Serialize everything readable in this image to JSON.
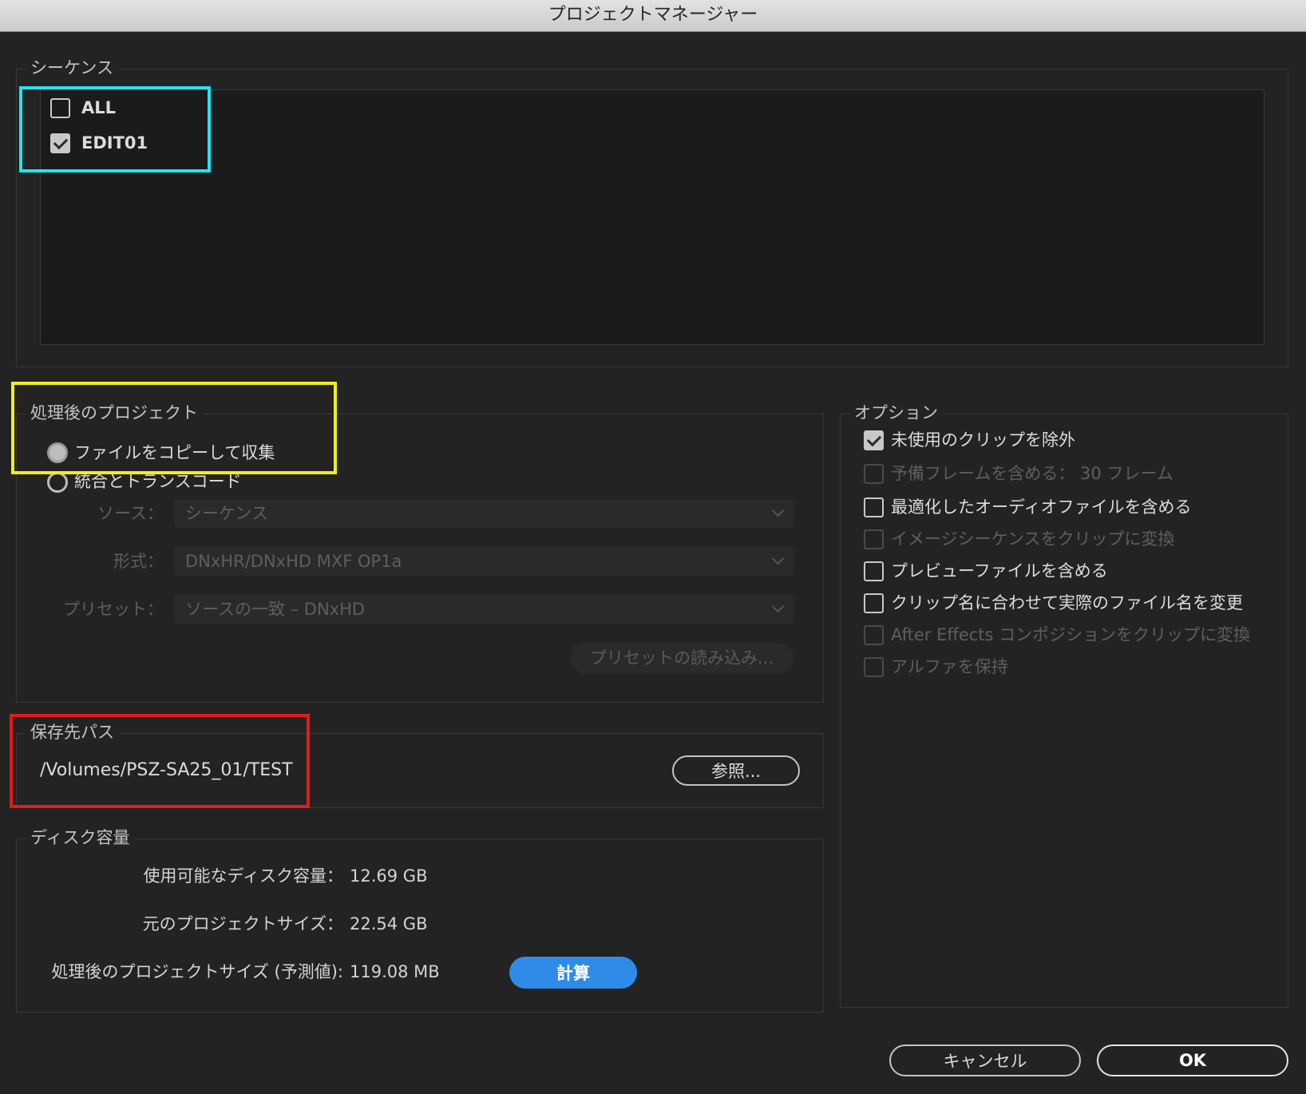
{
  "window": {
    "title": "プロジェクトマネージャー"
  },
  "sequences": {
    "title": "シーケンス",
    "items": [
      {
        "label": "ALL",
        "checked": false
      },
      {
        "label": "EDIT01",
        "checked": true
      }
    ]
  },
  "resulting_project": {
    "title": "処理後のプロジェクト",
    "options": [
      {
        "label": "ファイルをコピーして収集",
        "selected": true
      },
      {
        "label": "統合とトランスコード",
        "selected": false
      }
    ],
    "source_label": "ソース：",
    "source_value": "シーケンス",
    "format_label": "形式：",
    "format_value": "DNxHR/DNxHD MXF OP1a",
    "preset_label": "プリセット：",
    "preset_value": "ソースの一致 – DNxHD",
    "import_preset_button": "プリセットの読み込み..."
  },
  "destination": {
    "title": "保存先パス",
    "path": "/Volumes/PSZ-SA25_01/TEST",
    "browse_button": "参照..."
  },
  "disk_space": {
    "title": "ディスク容量",
    "available_label": "使用可能なディスク容量：",
    "available_value": "12.69 GB",
    "original_label": "元のプロジェクトサイズ：",
    "original_value": "22.54 GB",
    "resulting_label": "処理後のプロジェクトサイズ (予測値):",
    "resulting_value": "119.08 MB",
    "calculate_button": "計算"
  },
  "options": {
    "title": "オプション",
    "items": [
      {
        "label": "未使用のクリップを除外",
        "checked": true,
        "enabled": true
      },
      {
        "label": "予備フレームを含める： 30 フレーム",
        "checked": false,
        "enabled": false
      },
      {
        "label": "最適化したオーディオファイルを含める",
        "checked": false,
        "enabled": true
      },
      {
        "label": "イメージシーケンスをクリップに変換",
        "checked": false,
        "enabled": false
      },
      {
        "label": "プレビューファイルを含める",
        "checked": false,
        "enabled": true
      },
      {
        "label": "クリップ名に合わせて実際のファイル名を変更",
        "checked": false,
        "enabled": true
      },
      {
        "label": "After Effects コンポジションをクリップに変換",
        "checked": false,
        "enabled": false
      },
      {
        "label": "アルファを保持",
        "checked": false,
        "enabled": false
      }
    ]
  },
  "footer": {
    "cancel": "キャンセル",
    "ok": "OK"
  },
  "colors": {
    "background": "#232323",
    "accent_blue": "#2e8ce8",
    "highlight_cyan": "#22e5f0",
    "highlight_yellow": "#f2ee1c",
    "highlight_red": "#e51a1a"
  }
}
